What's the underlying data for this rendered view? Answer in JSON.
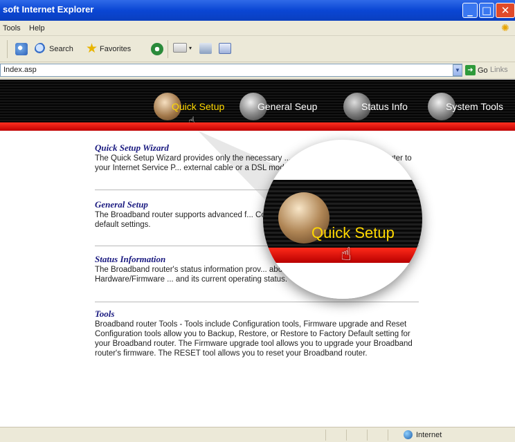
{
  "window": {
    "title": "soft Internet Explorer"
  },
  "menu": {
    "items": [
      "Tools",
      "Help"
    ]
  },
  "toolbar": {
    "search_label": "Search",
    "favorites_label": "Favorites"
  },
  "address": {
    "value": "Index.asp",
    "go_label": "Go",
    "links_label": "Links"
  },
  "nav": {
    "items": [
      {
        "label": "Quick Setup",
        "icon": "quick-setup-icon",
        "active": true
      },
      {
        "label": "General Seup",
        "icon": "general-setup-icon"
      },
      {
        "label": "Status Info",
        "icon": "status-info-icon"
      },
      {
        "label": "System Tools",
        "icon": "system-tools-icon"
      }
    ]
  },
  "sections": [
    {
      "title": "Quick Setup Wizard",
      "text": "The Quick Setup Wizard provides only the necessary ... connect your Broadband router to your Internet Service P... external cable or a DSL modem."
    },
    {
      "title": "General Setup",
      "text": "The Broadband router supports advanced f... Control, Hacker Attack Detection and DMZ ... default settings."
    },
    {
      "title": "Status Information",
      "text": "The Broadband router's status information prov... about your Broadband router: Hardware/Firmware ... and its current operating status."
    },
    {
      "title": "Tools",
      "text": "Broadband router Tools - Tools include Configuration tools, Firmware upgrade and Reset Configuration tools allow you to Backup, Restore, or Restore to Factory Default setting for your Broadband router. The Firmware upgrade tool allows you to upgrade your Broadband router's firmware. The RESET tool allows you to reset your Broadband router."
    }
  ],
  "magnifier": {
    "label": "Quick Setup"
  },
  "status": {
    "zone_label": "Internet"
  },
  "colors": {
    "titlebar": "#0a46d4",
    "banner_red": "#e01010",
    "active_nav": "#ffd800",
    "heading": "#1a1a80"
  }
}
